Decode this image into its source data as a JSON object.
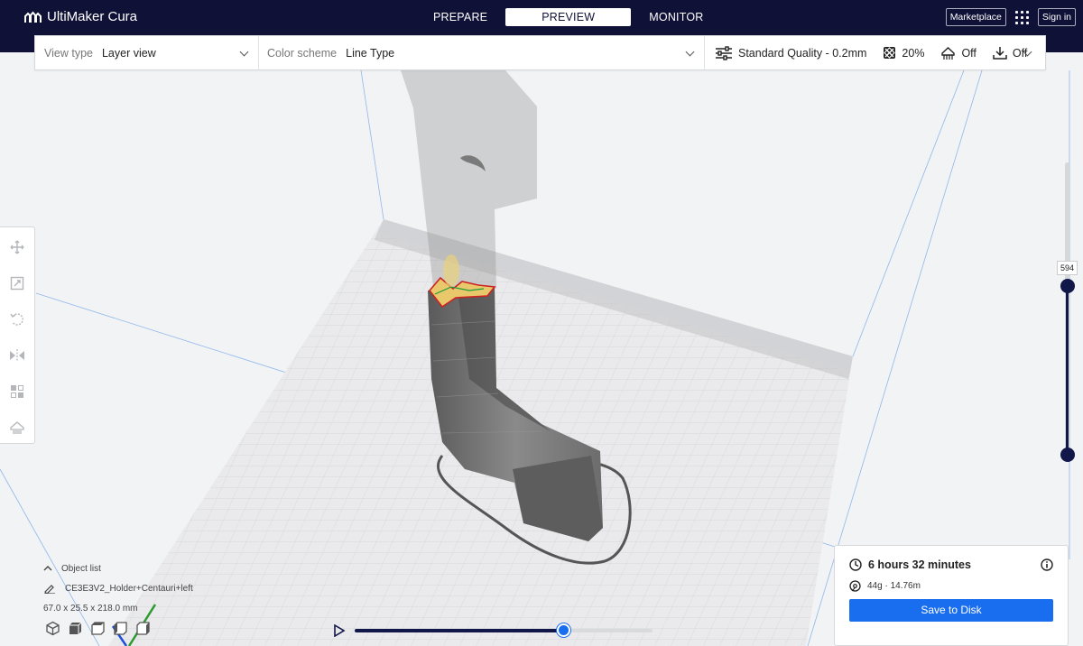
{
  "app": {
    "name": "UltiMaker Cura"
  },
  "stages": [
    {
      "label": "PREPARE"
    },
    {
      "label": "PREVIEW"
    },
    {
      "label": "MONITOR"
    }
  ],
  "header": {
    "marketplace": "Marketplace",
    "sign_in": "Sign in"
  },
  "toolbar": {
    "view_type_label": "View type",
    "view_type_value": "Layer view",
    "color_scheme_label": "Color scheme",
    "color_scheme_value": "Line Type",
    "quality": "Standard Quality - 0.2mm",
    "infill": "20%",
    "support": "Off",
    "adhesion": "Off"
  },
  "layer_slider": {
    "current_layer": "594"
  },
  "object_list": {
    "toggle_label": "Object list",
    "object_name": "CE3E3V2_Holder+Centauri+left",
    "dimensions": "67.0 x 25.5 x 218.0 mm"
  },
  "print_info": {
    "time": "6 hours 32 minutes",
    "material": "44g · 14.76m",
    "save_label": "Save to Disk"
  },
  "playback": {
    "progress": 0.7
  },
  "colors": {
    "header_bg": "#0f1137",
    "accent": "#196ef0",
    "slider": "#12174a"
  }
}
